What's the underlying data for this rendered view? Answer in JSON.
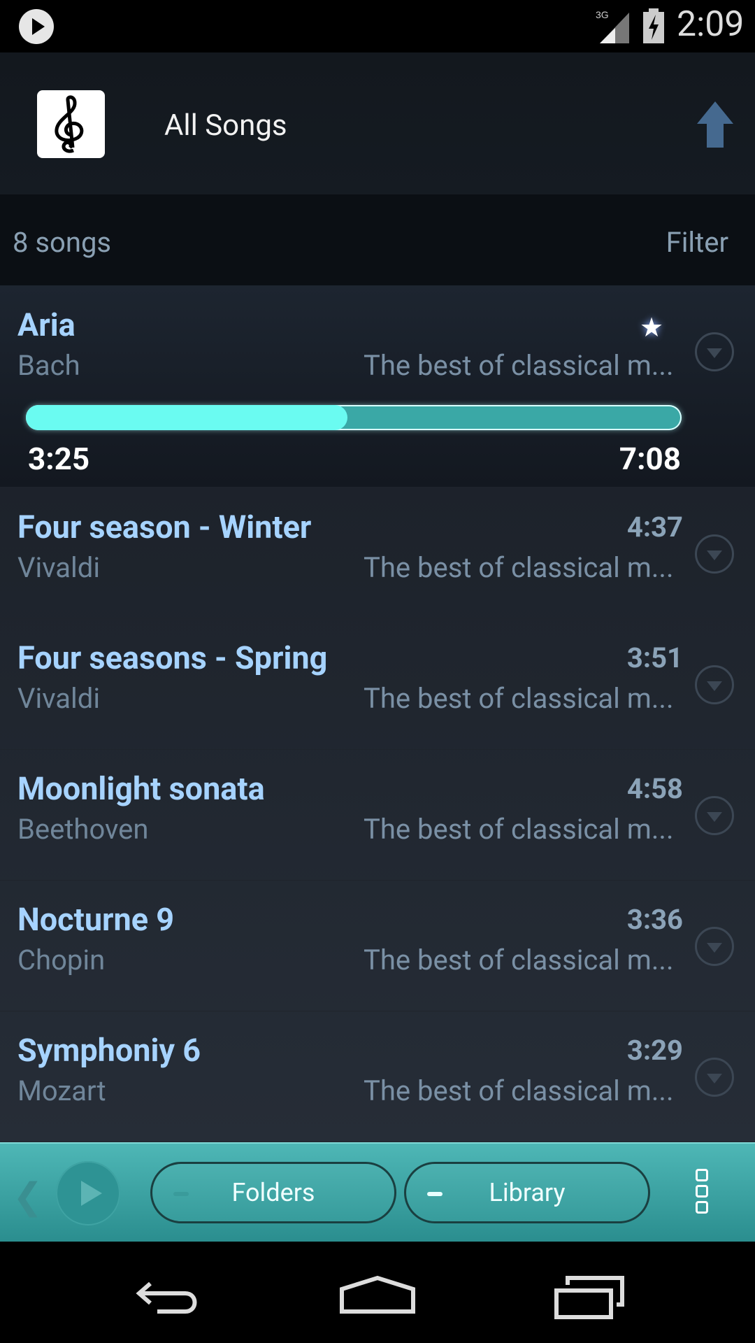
{
  "status_bar": {
    "time": "2:09",
    "network": "3G"
  },
  "header": {
    "title": "All Songs"
  },
  "info_bar": {
    "song_count": "8 songs",
    "filter_label": "Filter"
  },
  "now_playing": {
    "title": "Aria",
    "artist": "Bach",
    "album": "The best of classical m...",
    "elapsed": "3:25",
    "total": "7:08",
    "progress_fraction": 0.49,
    "favorite": true
  },
  "songs": [
    {
      "title": "Four season - Winter",
      "duration": "4:37",
      "artist": "Vivaldi",
      "album": "The best of classical m..."
    },
    {
      "title": "Four seasons - Spring",
      "duration": "3:51",
      "artist": "Vivaldi",
      "album": "The best of classical m..."
    },
    {
      "title": "Moonlight sonata",
      "duration": "4:58",
      "artist": "Beethoven",
      "album": "The best of classical m..."
    },
    {
      "title": "Nocturne 9",
      "duration": "3:36",
      "artist": "Chopin",
      "album": "The best of classical m..."
    },
    {
      "title": "Symphoniy 6",
      "duration": "3:29",
      "artist": "Mozart",
      "album": "The best of classical m..."
    }
  ],
  "player_bar": {
    "folders_label": "Folders",
    "library_label": "Library"
  },
  "colors": {
    "accent": "#6afbf1",
    "title_text": "#a6d3ff",
    "player_bar": "#3fa6a6"
  },
  "icons": {
    "status_play": "play-icon",
    "app": "treble-clef-icon",
    "up": "up-arrow-icon",
    "favorite": "star-icon",
    "row_menu": "dropdown-circle-icon",
    "prev": "chevron-left-icon",
    "play": "play-icon",
    "more": "overflow-menu-icon",
    "back": "back-icon",
    "home": "home-icon",
    "recents": "recents-icon"
  }
}
